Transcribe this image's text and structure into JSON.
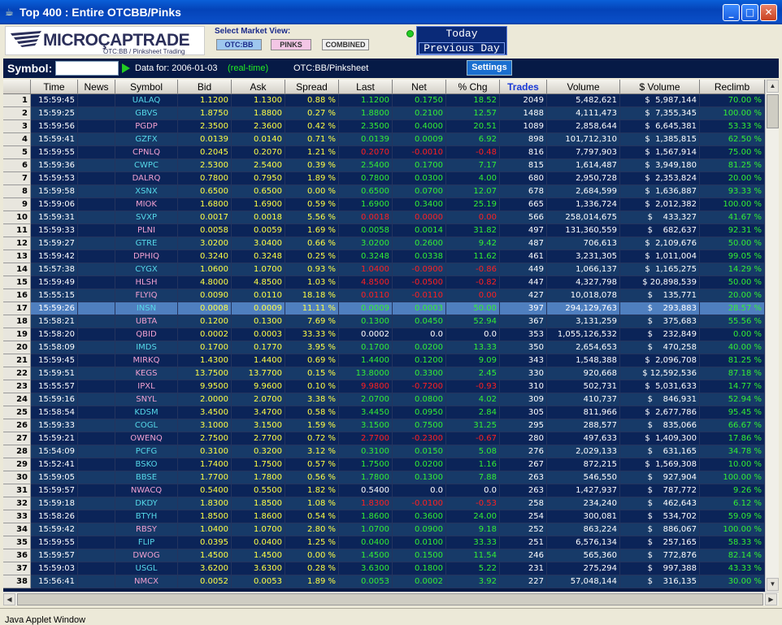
{
  "window": {
    "title": "Top 400 : Entire OTCBB/Pinks",
    "minimize": "_",
    "maximize": "□",
    "close": "✕",
    "icon": "java-cup-icon"
  },
  "header": {
    "logo_wordmark": "MicroCapTrade",
    "logo_wordmark_display": "MICROÇAPTRADE",
    "logo_tagline": "OTC:BB / Pinksheet Trading",
    "market_view_label": "Select Market View:",
    "market_buttons": [
      "OTC:BB",
      "PINKS",
      "COMBINED"
    ],
    "day_today": "Today",
    "day_previous": "Previous Day",
    "status_color": "#22cc22"
  },
  "toolbar": {
    "symbol_label": "Symbol:",
    "symbol_value": "",
    "data_for": "Data for: 2006-01-03",
    "realtime": "(real-time)",
    "feed": "OTC:BB/Pinksheet",
    "settings_label": "Settings"
  },
  "table": {
    "columns": [
      "",
      "Time",
      "News",
      "Symbol",
      "Bid",
      "Ask",
      "Spread",
      "Last",
      "Net",
      "% Chg",
      "Trades",
      "Volume",
      "$ Volume",
      "Reclimb"
    ],
    "sorted_column": "Trades",
    "selected_row": 17,
    "colors": {
      "otc": "#55d8e8",
      "pinks": "#f0a0d0",
      "price": "#ffff44",
      "up": "#33ee33",
      "down": "#ff2020",
      "flat": "#ffffff"
    },
    "rows": [
      [
        "1",
        "15:59:45",
        "",
        "UALAQ",
        "otc",
        "1.1200",
        "1.1300",
        "0.88 %",
        "1.1200",
        "0.1750",
        "18.52",
        "2049",
        "5,482,621",
        "$  5,987,144",
        "70.00 %",
        "up"
      ],
      [
        "2",
        "15:59:25",
        "",
        "GBVS",
        "otc",
        "1.8750",
        "1.8800",
        "0.27 %",
        "1.8800",
        "0.2100",
        "12.57",
        "1488",
        "4,111,473",
        "$  7,355,345",
        "100.00 %",
        "up"
      ],
      [
        "3",
        "15:59:56",
        "",
        "PGDP",
        "pinks",
        "2.3500",
        "2.3600",
        "0.42 %",
        "2.3500",
        "0.4000",
        "20.51",
        "1089",
        "2,858,644",
        "$  6,645,381",
        "53.33 %",
        "up"
      ],
      [
        "4",
        "15:59:41",
        "",
        "GZFX",
        "otc",
        "0.0139",
        "0.0140",
        "0.71 %",
        "0.0139",
        "0.0009",
        "6.92",
        "898",
        "101,712,310",
        "$  1,385,815",
        "62.50 %",
        "up"
      ],
      [
        "5",
        "15:59:55",
        "",
        "CPNLQ",
        "pinks",
        "0.2045",
        "0.2070",
        "1.21 %",
        "0.2070",
        "-0.0010",
        "-0.48",
        "816",
        "7,797,903",
        "$  1,567,914",
        "75.00 %",
        "down"
      ],
      [
        "6",
        "15:59:36",
        "",
        "CWPC",
        "otc",
        "2.5300",
        "2.5400",
        "0.39 %",
        "2.5400",
        "0.1700",
        "7.17",
        "815",
        "1,614,487",
        "$  3,949,180",
        "81.25 %",
        "up"
      ],
      [
        "7",
        "15:59:53",
        "",
        "DALRQ",
        "pinks",
        "0.7800",
        "0.7950",
        "1.89 %",
        "0.7800",
        "0.0300",
        "4.00",
        "680",
        "2,950,728",
        "$  2,353,824",
        "20.00 %",
        "up"
      ],
      [
        "8",
        "15:59:58",
        "",
        "XSNX",
        "otc",
        "0.6500",
        "0.6500",
        "0.00 %",
        "0.6500",
        "0.0700",
        "12.07",
        "678",
        "2,684,599",
        "$  1,636,887",
        "93.33 %",
        "up"
      ],
      [
        "9",
        "15:59:06",
        "",
        "MIOK",
        "pinks",
        "1.6800",
        "1.6900",
        "0.59 %",
        "1.6900",
        "0.3400",
        "25.19",
        "665",
        "1,336,724",
        "$  2,012,382",
        "100.00 %",
        "up"
      ],
      [
        "10",
        "15:59:31",
        "",
        "SVXP",
        "otc",
        "0.0017",
        "0.0018",
        "5.56 %",
        "0.0018",
        "0.0000",
        "0.00",
        "566",
        "258,014,675",
        "$    433,327",
        "41.67 %",
        "down"
      ],
      [
        "11",
        "15:59:33",
        "",
        "PLNI",
        "pinks",
        "0.0058",
        "0.0059",
        "1.69 %",
        "0.0058",
        "0.0014",
        "31.82",
        "497",
        "131,360,559",
        "$    682,637",
        "92.31 %",
        "up"
      ],
      [
        "12",
        "15:59:27",
        "",
        "GTRE",
        "otc",
        "3.0200",
        "3.0400",
        "0.66 %",
        "3.0200",
        "0.2600",
        "9.42",
        "487",
        "706,613",
        "$  2,109,676",
        "50.00 %",
        "up"
      ],
      [
        "13",
        "15:59:42",
        "",
        "DPHIQ",
        "pinks",
        "0.3240",
        "0.3248",
        "0.25 %",
        "0.3248",
        "0.0338",
        "11.62",
        "461",
        "3,231,305",
        "$  1,011,004",
        "99.05 %",
        "up"
      ],
      [
        "14",
        "15:57:38",
        "",
        "CYGX",
        "otc",
        "1.0600",
        "1.0700",
        "0.93 %",
        "1.0400",
        "-0.0900",
        "-0.86",
        "449",
        "1,066,137",
        "$  1,165,275",
        "14.29 %",
        "down"
      ],
      [
        "15",
        "15:59:49",
        "",
        "HLSH",
        "pinks",
        "4.8000",
        "4.8500",
        "1.03 %",
        "4.8500",
        "-0.0500",
        "-0.82",
        "447",
        "4,327,798",
        "$ 20,898,539",
        "50.00 %",
        "down"
      ],
      [
        "16",
        "15:55:15",
        "",
        "FLYIQ",
        "pinks",
        "0.0090",
        "0.0110",
        "18.18 %",
        "0.0110",
        "-0.0110",
        "0.00",
        "427",
        "10,018,078",
        "$    135,771",
        "20.00 %",
        "down"
      ],
      [
        "17",
        "15:59:26",
        "",
        "INSN",
        "otc",
        "0.0008",
        "0.0009",
        "11.11 %",
        "0.0009",
        "0.0003",
        "50.00",
        "397",
        "294,129,763",
        "$    293,883",
        "28.57 %",
        "up"
      ],
      [
        "18",
        "15:58:21",
        "",
        "UBTA",
        "pinks",
        "0.1200",
        "0.1300",
        "7.69 %",
        "0.1300",
        "0.0450",
        "52.94",
        "367",
        "3,131,259",
        "$    375,683",
        "55.56 %",
        "up"
      ],
      [
        "19",
        "15:58:20",
        "",
        "QBID",
        "pinks",
        "0.0002",
        "0.0003",
        "33.33 %",
        "0.0002",
        "0.0",
        "0.0",
        "353",
        "1,055,126,532",
        "$    232,849",
        "0.00 %",
        "flat"
      ],
      [
        "20",
        "15:58:09",
        "",
        "IMDS",
        "otc",
        "0.1700",
        "0.1770",
        "3.95 %",
        "0.1700",
        "0.0200",
        "13.33",
        "350",
        "2,654,653",
        "$    470,258",
        "40.00 %",
        "up"
      ],
      [
        "21",
        "15:59:45",
        "",
        "MIRKQ",
        "pinks",
        "1.4300",
        "1.4400",
        "0.69 %",
        "1.4400",
        "0.1200",
        "9.09",
        "343",
        "1,548,388",
        "$  2,096,708",
        "81.25 %",
        "up"
      ],
      [
        "22",
        "15:59:51",
        "",
        "KEGS",
        "pinks",
        "13.7500",
        "13.7700",
        "0.15 %",
        "13.8000",
        "0.3300",
        "2.45",
        "330",
        "920,668",
        "$ 12,592,536",
        "87.18 %",
        "up"
      ],
      [
        "23",
        "15:55:57",
        "",
        "IPXL",
        "pinks",
        "9.9500",
        "9.9600",
        "0.10 %",
        "9.9800",
        "-0.7200",
        "-0.93",
        "310",
        "502,731",
        "$  5,031,633",
        "14.77 %",
        "down"
      ],
      [
        "24",
        "15:59:16",
        "",
        "SNYL",
        "pinks",
        "2.0000",
        "2.0700",
        "3.38 %",
        "2.0700",
        "0.0800",
        "4.02",
        "309",
        "410,737",
        "$    846,931",
        "52.94 %",
        "up"
      ],
      [
        "25",
        "15:58:54",
        "",
        "KDSM",
        "otc",
        "3.4500",
        "3.4700",
        "0.58 %",
        "3.4450",
        "0.0950",
        "2.84",
        "305",
        "811,966",
        "$  2,677,786",
        "95.45 %",
        "up"
      ],
      [
        "26",
        "15:59:33",
        "",
        "COGL",
        "otc",
        "3.1000",
        "3.1500",
        "1.59 %",
        "3.1500",
        "0.7500",
        "31.25",
        "295",
        "288,577",
        "$    835,066",
        "66.67 %",
        "up"
      ],
      [
        "27",
        "15:59:21",
        "",
        "OWENQ",
        "pinks",
        "2.7500",
        "2.7700",
        "0.72 %",
        "2.7700",
        "-0.2300",
        "-0.67",
        "280",
        "497,633",
        "$  1,409,300",
        "17.86 %",
        "down"
      ],
      [
        "28",
        "15:54:09",
        "",
        "PCFG",
        "otc",
        "0.3100",
        "0.3200",
        "3.12 %",
        "0.3100",
        "0.0150",
        "5.08",
        "276",
        "2,029,133",
        "$    631,165",
        "34.78 %",
        "up"
      ],
      [
        "29",
        "15:52:41",
        "",
        "BSKO",
        "otc",
        "1.7400",
        "1.7500",
        "0.57 %",
        "1.7500",
        "0.0200",
        "1.16",
        "267",
        "872,215",
        "$  1,569,308",
        "10.00 %",
        "up"
      ],
      [
        "30",
        "15:59:05",
        "",
        "BBSE",
        "otc",
        "1.7700",
        "1.7800",
        "0.56 %",
        "1.7800",
        "0.1300",
        "7.88",
        "263",
        "546,550",
        "$    927,904",
        "100.00 %",
        "up"
      ],
      [
        "31",
        "15:59:57",
        "",
        "NWACQ",
        "pinks",
        "0.5400",
        "0.5500",
        "1.82 %",
        "0.5400",
        "0.0",
        "0.0",
        "263",
        "1,427,937",
        "$    787,772",
        "9.26 %",
        "flat"
      ],
      [
        "32",
        "15:59:18",
        "",
        "DKDY",
        "otc",
        "1.8300",
        "1.8500",
        "1.08 %",
        "1.8300",
        "-0.0100",
        "-0.53",
        "258",
        "234,240",
        "$    462,643",
        "6.12 %",
        "down"
      ],
      [
        "33",
        "15:58:26",
        "",
        "BTYH",
        "otc",
        "1.8500",
        "1.8600",
        "0.54 %",
        "1.8600",
        "0.3600",
        "24.00",
        "254",
        "300,081",
        "$    534,702",
        "59.09 %",
        "up"
      ],
      [
        "34",
        "15:59:42",
        "",
        "RBSY",
        "pinks",
        "1.0400",
        "1.0700",
        "2.80 %",
        "1.0700",
        "0.0900",
        "9.18",
        "252",
        "863,224",
        "$    886,067",
        "100.00 %",
        "up"
      ],
      [
        "35",
        "15:59:55",
        "",
        "FLIP",
        "otc",
        "0.0395",
        "0.0400",
        "1.25 %",
        "0.0400",
        "0.0100",
        "33.33",
        "251",
        "6,576,134",
        "$    257,165",
        "58.33 %",
        "up"
      ],
      [
        "36",
        "15:59:57",
        "",
        "DWOG",
        "pinks",
        "1.4500",
        "1.4500",
        "0.00 %",
        "1.4500",
        "0.1500",
        "11.54",
        "246",
        "565,360",
        "$    772,876",
        "82.14 %",
        "up"
      ],
      [
        "37",
        "15:59:03",
        "",
        "USGL",
        "otc",
        "3.6200",
        "3.6300",
        "0.28 %",
        "3.6300",
        "0.1800",
        "5.22",
        "231",
        "275,294",
        "$    997,388",
        "43.33 %",
        "up"
      ],
      [
        "38",
        "15:56:41",
        "",
        "NMCX",
        "pinks",
        "0.0052",
        "0.0053",
        "1.89 %",
        "0.0053",
        "0.0002",
        "3.92",
        "227",
        "57,048,144",
        "$    316,135",
        "30.00 %",
        "up"
      ]
    ]
  },
  "status_bar": {
    "text": "Java Applet Window"
  }
}
